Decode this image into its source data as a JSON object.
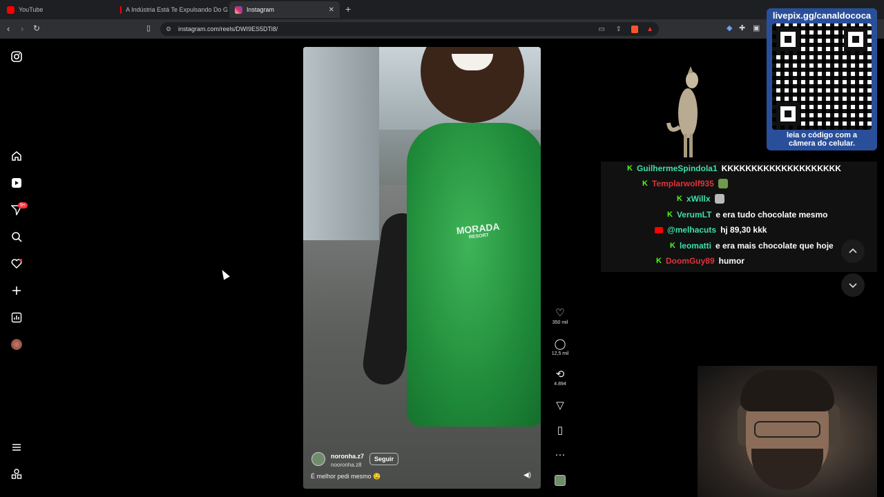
{
  "browser": {
    "tabs": [
      {
        "label": "YouTube",
        "favicon_color": "#ff0000"
      },
      {
        "label": "A Indústria Está Te Expulsando Do G",
        "favicon_color": "#ff0000"
      },
      {
        "label": "Instagram",
        "favicon_color": "#d62976",
        "active": true
      }
    ],
    "url": "instagram.com/reels/DWI9ES5DTi8/"
  },
  "sidebar": {
    "notification_badge": "9+"
  },
  "reel": {
    "username": "noronha.z7",
    "subtitle": "nooronha.z8",
    "follow_label": "Seguir",
    "caption": "É melhor pedi mesmo 🤤",
    "shirt_logo": "MORADA",
    "shirt_logo_sub": "RESORT",
    "likes": "350 mil",
    "comments": "12,5 mil",
    "reposts": "4.894"
  },
  "overlay": {
    "qr_title": "livepix.gg/canaldococa",
    "qr_footer_1": "leia o código com a",
    "qr_footer_2": "câmera do celular."
  },
  "chat": [
    {
      "platform": "kick",
      "user": "GuilhermeSpindola1",
      "color": "#3ee0a8",
      "msg": "KKKKKKKKKKKKKKKKKKKK"
    },
    {
      "platform": "kick",
      "user": "Templarwolf935",
      "color": "#e0323d",
      "msg": ""
    },
    {
      "platform": "kick",
      "user": "xWillx",
      "color": "#3ee0a8",
      "msg": ""
    },
    {
      "platform": "kick",
      "user": "VerumLT",
      "color": "#3ee0a8",
      "msg": "e era tudo chocolate mesmo"
    },
    {
      "platform": "youtube",
      "user": "@melhacuts",
      "color": "#3ee0a8",
      "msg": "hj 89,30 kkk"
    },
    {
      "platform": "kick",
      "user": "leomatti",
      "color": "#3ee0a8",
      "msg": "e era mais chocolate que hoje"
    },
    {
      "platform": "kick",
      "user": "DoomGuy89",
      "color": "#e0323d",
      "msg": "humor"
    }
  ]
}
